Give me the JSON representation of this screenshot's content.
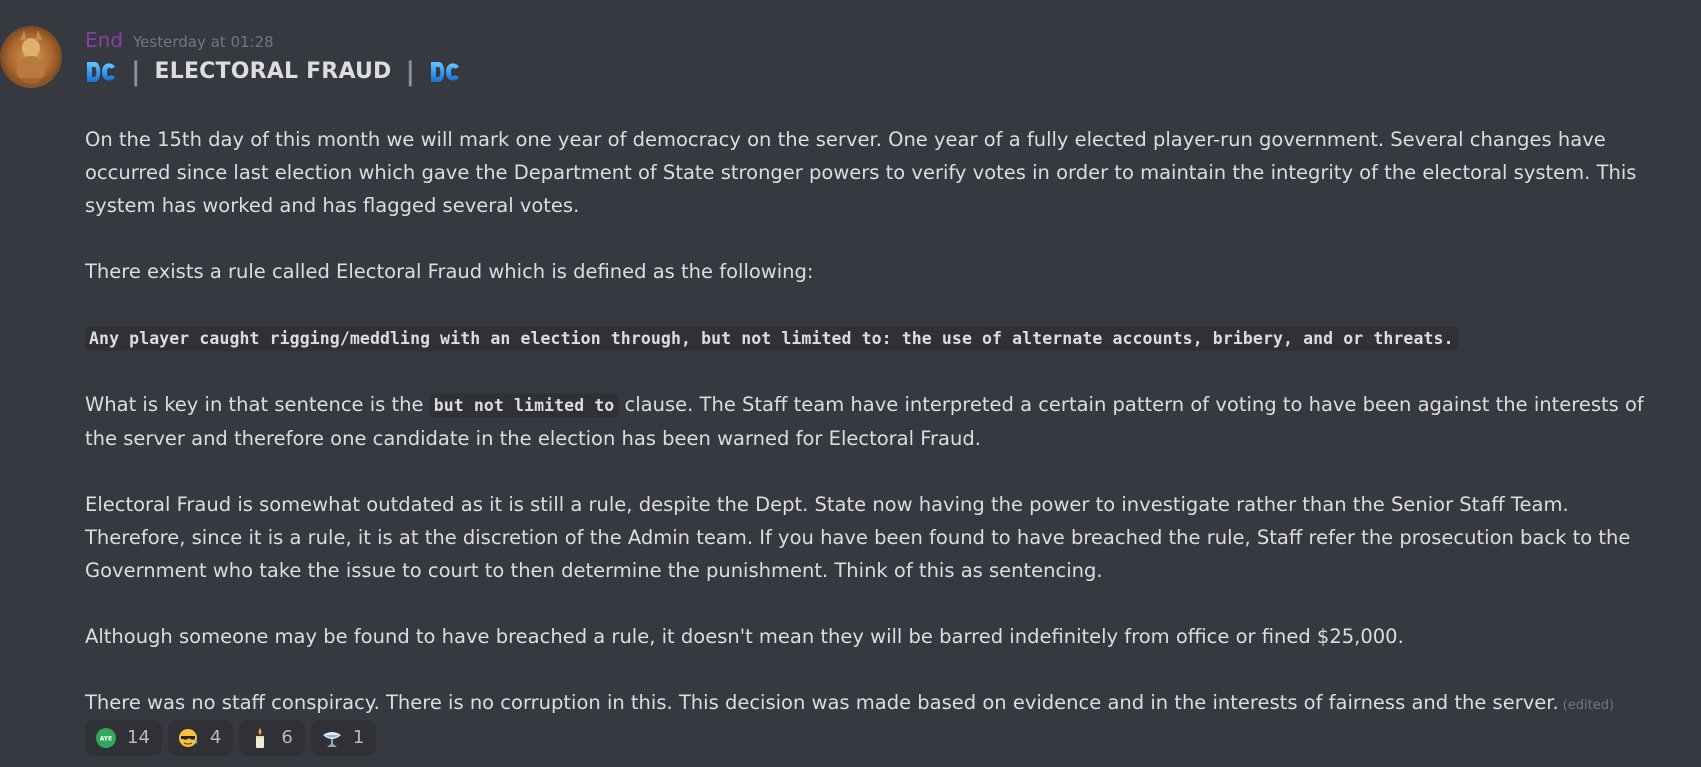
{
  "message": {
    "username": "End",
    "timestamp": "Yesterday at 01:28",
    "username_color": "#8a3fa6",
    "title": {
      "left_emoji": "dc-logo-icon",
      "separator": "|",
      "text": "ELECTORAL FRAUD",
      "right_emoji": "dc-logo-icon"
    },
    "paragraphs": {
      "p1": "On the 15th day of this month we will mark one year of democracy on the server. One year of a fully elected player-run government. Several changes have occurred since last election which gave the Department of State stronger powers to verify votes in order to maintain the integrity of the electoral system. This system has worked and has flagged several votes.",
      "p2": "There exists a rule called Electoral Fraud which is defined as the following:",
      "code_block": "Any player caught rigging/meddling with an election through, but not limited to: the use of alternate accounts, bribery, and or threats.",
      "p4_before": "What is key in that sentence is the ",
      "p4_code": "but not limited to",
      "p4_after": " clause. The Staff team have interpreted a certain pattern of voting to have been against the interests of the server and therefore one candidate in the election has been warned for Electoral Fraud.",
      "p5": "Electoral Fraud is somewhat outdated as it is still a rule, despite the Dept. State now having the power to investigate rather than the Senior Staff Team. Therefore, since it is a rule, it is at the discretion of the Admin team. If you have been found to have breached the rule, Staff refer the prosecution back to the Government who take the issue to court to then determine the punishment. Think of this as sentencing.",
      "p6": "Although someone may be found to have breached a rule, it doesn't mean they will be barred indefinitely from office or fined $25,000.",
      "p7": "There was no staff conspiracy. There is no corruption in this. This decision was made based on evidence and in the interests of fairness and the server."
    },
    "edited_label": "(edited)"
  },
  "reactions": [
    {
      "emoji": "aye-icon",
      "count": "14"
    },
    {
      "emoji": "sunglasses-sweat-icon",
      "count": "4"
    },
    {
      "emoji": "candle-icon",
      "count": "6"
    },
    {
      "emoji": "satellite-dish-icon",
      "count": "1"
    }
  ],
  "colors": {
    "background": "#36393f",
    "text": "#dcddde",
    "muted": "#72767d",
    "code_bg": "#2f3136",
    "reaction_bg": "#2f3136"
  }
}
